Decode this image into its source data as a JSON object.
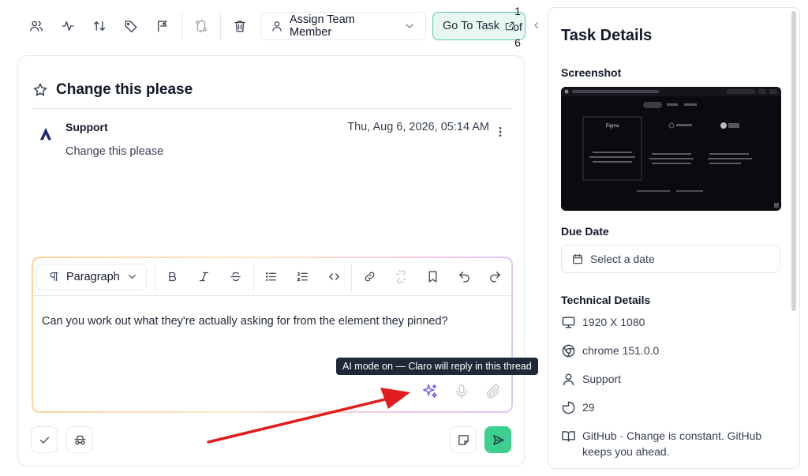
{
  "toolbar": {
    "assign_label": "Assign Team Member",
    "goto_label": "Go To Task",
    "page_current": "1",
    "page_of": "of",
    "page_total": "6"
  },
  "ticket": {
    "title": "Change this please"
  },
  "message": {
    "author": "Support",
    "body": "Change this please",
    "timestamp": "Thu, Aug 6, 2026, 05:14 AM"
  },
  "editor": {
    "block_type": "Paragraph",
    "text": "Can you work out what they're actually asking for from the element they pinned?",
    "tooltip": "AI mode on — Claro will reply in this thread"
  },
  "panel": {
    "title": "Task Details",
    "screenshot_label": "Screenshot",
    "due_label": "Due Date",
    "due_placeholder": "Select a date",
    "tech_label": "Technical Details",
    "resolution": "1920 X 1080",
    "browser": "chrome 151.0.0",
    "user": "Support",
    "count": "29",
    "page": "GitHub · Change is constant. GitHub keeps you ahead."
  },
  "thumbnail": {
    "card_title": "Figma"
  },
  "colors": {
    "accent_green": "#3ccf90",
    "goto_bg": "#e7f8f1",
    "ai_purple": "#7c5cf0",
    "arrow_red": "#e11d1d"
  }
}
